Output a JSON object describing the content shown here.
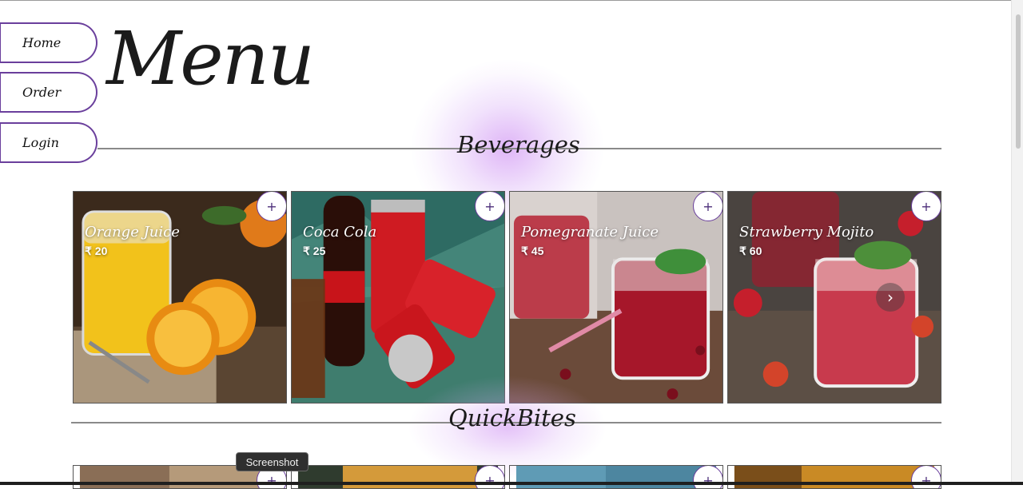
{
  "nav": {
    "home_label": "Home",
    "order_label": "Order",
    "login_label": "Login"
  },
  "page": {
    "title": "Menu"
  },
  "sections": {
    "beverages": "Beverages",
    "quick_bites": "QuickBites"
  },
  "beverages": [
    {
      "name": "Orange Juice",
      "price": "₹ 20"
    },
    {
      "name": "Coca Cola",
      "price": "₹ 25"
    },
    {
      "name": "Pomegranate Juice",
      "price": "₹ 45"
    },
    {
      "name": "Strawberry Mojito",
      "price": "₹ 60"
    }
  ],
  "add_symbol": "+",
  "next_symbol": "›",
  "tooltip": {
    "text": "Screenshot"
  },
  "colors": {
    "accent": "#6a3f9c",
    "glow": "#c478f0"
  }
}
